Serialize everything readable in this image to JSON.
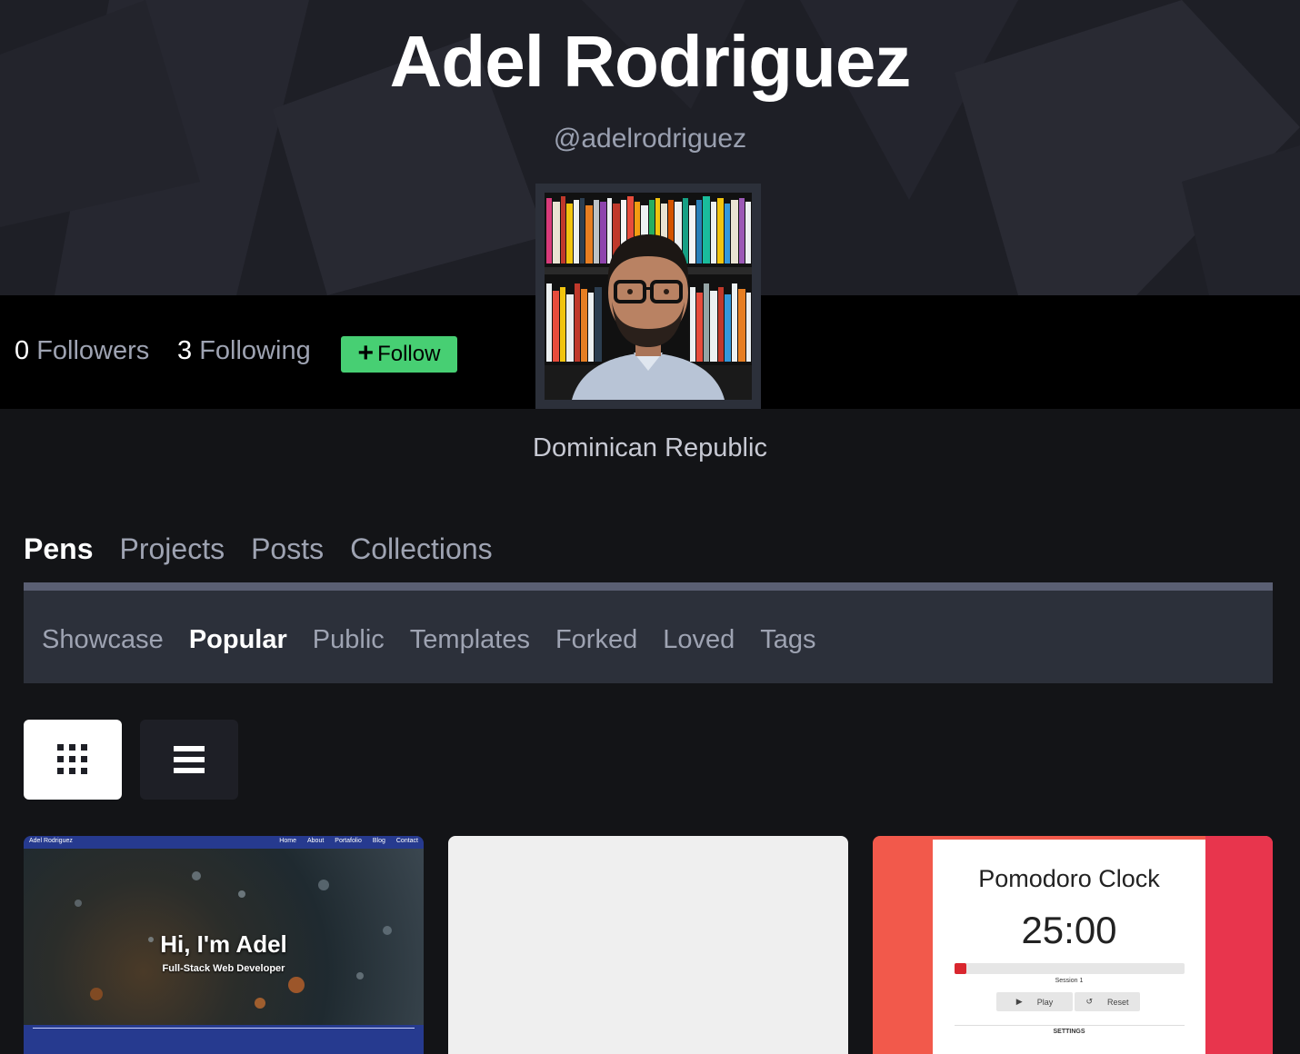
{
  "profile": {
    "name": "Adel Rodriguez",
    "handle": "@adelrodriguez",
    "location": "Dominican Republic",
    "followers_count": "0",
    "followers_label": "Followers",
    "following_count": "3",
    "following_label": "Following",
    "follow_button": "Follow"
  },
  "tabs": [
    {
      "label": "Pens",
      "active": true
    },
    {
      "label": "Projects",
      "active": false
    },
    {
      "label": "Posts",
      "active": false
    },
    {
      "label": "Collections",
      "active": false
    }
  ],
  "subnav": [
    {
      "label": "Showcase",
      "active": false
    },
    {
      "label": "Popular",
      "active": true
    },
    {
      "label": "Public",
      "active": false
    },
    {
      "label": "Templates",
      "active": false
    },
    {
      "label": "Forked",
      "active": false
    },
    {
      "label": "Loved",
      "active": false
    },
    {
      "label": "Tags",
      "active": false
    }
  ],
  "view_toggle": {
    "grid_icon": "grid-icon",
    "list_icon": "list-icon",
    "selected": "grid"
  },
  "cards": {
    "portfolio": {
      "brand": "Adel Rodriguez",
      "nav_links": [
        "Home",
        "About",
        "Portafolio",
        "Blog",
        "Contact"
      ],
      "title": "Hi, I'm Adel",
      "subtitle": "Full-Stack Web Developer"
    },
    "pomodoro": {
      "title": "Pomodoro Clock",
      "time": "25:00",
      "progress": 0.05,
      "session": "Session 1",
      "play_label": "Play",
      "reset_label": "Reset",
      "settings_label": "SETTINGS"
    }
  },
  "colors": {
    "accent_green": "#47cf73",
    "bar_red": "#d9262e"
  }
}
